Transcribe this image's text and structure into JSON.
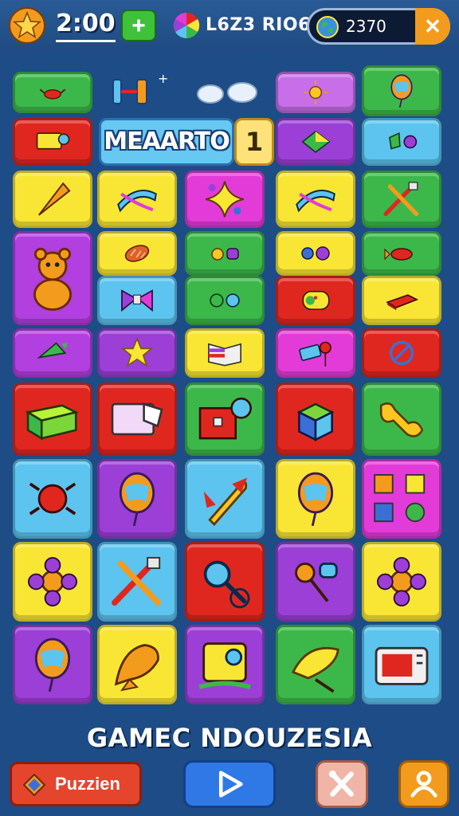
{
  "hud": {
    "timer": "2:00",
    "title": "L6Z3 RIO6",
    "score": "2370",
    "plus_label": "+",
    "close_label": "✕"
  },
  "board": {
    "word_tile": "MEAARTO",
    "number_tile": "1"
  },
  "footer": {
    "banner": "GAMEC NDOUZESIA",
    "puzzle_label": "Puzzien"
  },
  "colors": {
    "background": "#1d4c86",
    "green": "#3ec23a",
    "yellow": "#f9e634",
    "purple": "#9b3fd6",
    "blue": "#5cc4ef",
    "red": "#e0271f",
    "magenta": "#e33bd8",
    "orange": "#f39b1d"
  },
  "tiles": [
    {
      "color": "#3cb84a",
      "icon": "crab-icon"
    },
    {
      "color": "#c76ee8",
      "icon": "sun-icon"
    },
    {
      "color": "#3cb84a",
      "icon": "balloon-icon"
    },
    {
      "color": "#e0271f",
      "icon": "machine-icon"
    },
    {
      "color": "#9b3fd6",
      "icon": "arrow-gem-icon"
    },
    {
      "color": "#5cc4ef",
      "icon": "shapes-icon"
    },
    {
      "color": "#f9e634",
      "icon": "cone-icon"
    },
    {
      "color": "#f9e634",
      "icon": "ribbon-icon"
    },
    {
      "color": "#e33bd8",
      "icon": "star-shape-icon"
    },
    {
      "color": "#f9e634",
      "icon": "ribbon-icon"
    },
    {
      "color": "#3cb84a",
      "icon": "tools-icon"
    },
    {
      "color": "#b23fe0",
      "icon": "teddy-bear-icon"
    },
    {
      "color": "#f9e634",
      "icon": "bread-icon"
    },
    {
      "color": "#3cb84a",
      "icon": "dots-icon"
    },
    {
      "color": "#f9e634",
      "icon": "flowers-icon"
    },
    {
      "color": "#3cb84a",
      "icon": "fish-icon"
    },
    {
      "color": "#5cc4ef",
      "icon": "bow-icon"
    },
    {
      "color": "#3cb84a",
      "icon": "circles-icon"
    },
    {
      "color": "#e0271f",
      "icon": "paint-can-icon"
    },
    {
      "color": "#f9e634",
      "icon": "box-icon"
    },
    {
      "color": "#b23fe0",
      "icon": "gem-icon"
    },
    {
      "color": "#9b3fd6",
      "icon": "star-icon"
    },
    {
      "color": "#f9e634",
      "icon": "book-icon"
    },
    {
      "color": "#e33bd8",
      "icon": "phone-icon"
    },
    {
      "color": "#e0271f",
      "icon": "no-sign-icon"
    },
    {
      "color": "#e0271f",
      "icon": "block-icon"
    },
    {
      "color": "#e0271f",
      "icon": "paper-icon"
    },
    {
      "color": "#3cb84a",
      "icon": "chest-icon"
    },
    {
      "color": "#e0271f",
      "icon": "cube-icon"
    },
    {
      "color": "#3cb84a",
      "icon": "bone-icon"
    },
    {
      "color": "#5cc4ef",
      "icon": "bug-icon"
    },
    {
      "color": "#9b3fd6",
      "icon": "balloon-icon"
    },
    {
      "color": "#5cc4ef",
      "icon": "rocket-icon"
    },
    {
      "color": "#f9e634",
      "icon": "balloon-icon"
    },
    {
      "color": "#e33bd8",
      "icon": "letters-icon"
    },
    {
      "color": "#f9e634",
      "icon": "flower-icon"
    },
    {
      "color": "#5cc4ef",
      "icon": "tools-icon"
    },
    {
      "color": "#e0271f",
      "icon": "magnifier-icon"
    },
    {
      "color": "#9b3fd6",
      "icon": "rattle-icon"
    },
    {
      "color": "#f9e634",
      "icon": "flower-icon"
    },
    {
      "color": "#9b3fd6",
      "icon": "balloon-icon"
    },
    {
      "color": "#f9e634",
      "icon": "bird-icon"
    },
    {
      "color": "#9b3fd6",
      "icon": "scroll-icon"
    },
    {
      "color": "#3cb84a",
      "icon": "brush-icon"
    },
    {
      "color": "#5cc4ef",
      "icon": "radio-icon"
    }
  ]
}
